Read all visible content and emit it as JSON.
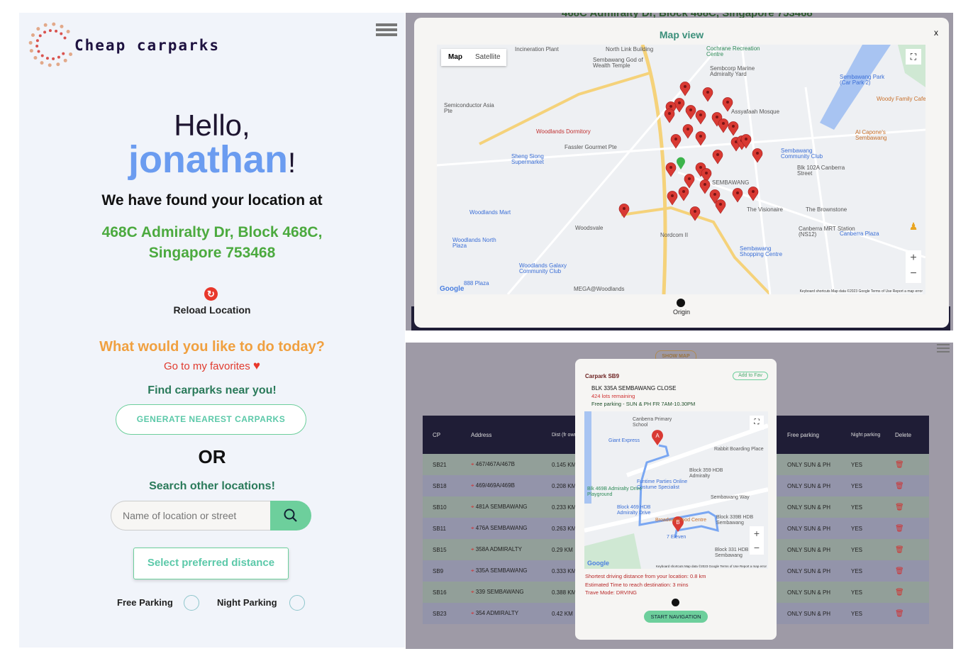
{
  "app": {
    "title": "Cheap carparks"
  },
  "home": {
    "greeting": "Hello,",
    "username": "jonathan",
    "exclaim": "!",
    "found_label": "We have found your location at",
    "address": "468C Admiralty Dr, Block 468C, Singapore 753468",
    "reload_label": "Reload Location",
    "question": "What would you like to do today?",
    "favorites_link": "Go to my favorites",
    "find_label": "Find carparks near you!",
    "generate_button": "GENERATE NEAREST CARPARKS",
    "or_label": "OR",
    "search_label": "Search other locations!",
    "search_placeholder": "Name of location or street",
    "distance_button": "Select preferred distance",
    "free_parking_label": "Free Parking",
    "night_parking_label": "Night Parking"
  },
  "map_modal": {
    "behind_address": "468C Admiralty Dr, Block 468C, Singapore 753468",
    "title": "Map view",
    "close": "x",
    "map_tab": "Map",
    "satellite_tab": "Satellite",
    "origin_label": "Origin",
    "footer": "Keyboard shortcuts   Map data ©2023 Google   Terms of Use   Report a map error",
    "labels": [
      {
        "t": "North Link Building",
        "c": ""
      },
      {
        "t": "Cochrane Recreation Centre",
        "c": "g"
      },
      {
        "t": "Incineration Plant",
        "c": ""
      },
      {
        "t": "Sembawang God of Wealth Temple",
        "c": ""
      },
      {
        "t": "Sembcorp Marine Admiralty Yard",
        "c": ""
      },
      {
        "t": "Semiconductor Asia Pte",
        "c": ""
      },
      {
        "t": "Woodlands Dormitory",
        "c": "r"
      },
      {
        "t": "Assyafaah Mosque",
        "c": ""
      },
      {
        "t": "Sembawang Park (Car Park 2)",
        "c": "b"
      },
      {
        "t": "Woody Family Cafe",
        "c": "o"
      },
      {
        "t": "Al Capone's Sembawang",
        "c": "o"
      },
      {
        "t": "Fassler Gourmet Pte",
        "c": ""
      },
      {
        "t": "Sheng Siong Supermarket",
        "c": "b"
      },
      {
        "t": "Sembawang Community Club",
        "c": "b"
      },
      {
        "t": "Blk 102A Canberra Street",
        "c": ""
      },
      {
        "t": "SEMBAWANG",
        "c": ""
      },
      {
        "t": "Woodlands Mart",
        "c": "b"
      },
      {
        "t": "The Visionaire",
        "c": ""
      },
      {
        "t": "The Brownstone",
        "c": ""
      },
      {
        "t": "Woodlands North Plaza",
        "c": "b"
      },
      {
        "t": "Canberra MRT Station (NS12)",
        "c": ""
      },
      {
        "t": "Canberra Plaza",
        "c": "b"
      },
      {
        "t": "Sembawang Shopping Centre",
        "c": "b"
      },
      {
        "t": "Woodlands Galaxy Community Club",
        "c": "b"
      },
      {
        "t": "888 Plaza",
        "c": "b"
      },
      {
        "t": "MEGA@Woodlands",
        "c": ""
      },
      {
        "t": "Nordcom II",
        "c": ""
      },
      {
        "t": "Woodsvale",
        "c": ""
      }
    ]
  },
  "table": {
    "show_map": "SHOW MAP",
    "headers": [
      "CP",
      "Address",
      "Dist (fr own)",
      "Free parking",
      "Night parking",
      "Delete"
    ],
    "rows": [
      [
        "SB21",
        "467/467A/467B",
        "0.145 KM",
        "ONLY SUN & PH",
        "YES"
      ],
      [
        "SB18",
        "469/469A/469B",
        "0.208 KM",
        "ONLY SUN & PH",
        "YES"
      ],
      [
        "SB10",
        "481A SEMBAWANG",
        "0.233 KM",
        "ONLY SUN & PH",
        "YES"
      ],
      [
        "SB11",
        "476A SEMBAWANG",
        "0.263 KM",
        "ONLY SUN & PH",
        "YES"
      ],
      [
        "SB15",
        "358A ADMIRALTY",
        "0.29 KM",
        "ONLY SUN & PH",
        "YES"
      ],
      [
        "SB9",
        "335A SEMBAWANG",
        "0.333 KM",
        "ONLY SUN & PH",
        "YES"
      ],
      [
        "SB16",
        "339 SEMBAWANG",
        "0.388 KM",
        "ONLY SUN & PH",
        "YES"
      ],
      [
        "SB23",
        "354 ADMIRALTY",
        "0.42 KM",
        "ONLY SUN & PH",
        "YES"
      ]
    ]
  },
  "carpark_card": {
    "title": "Carpark SB9",
    "fav_button": "Add to Fav",
    "address": "BLK 335A SEMBAWANG CLOSE",
    "lots": "424 lots remaining",
    "free_parking": "Free parking - SUN & PH FR 7AM-10.30PM",
    "distance": "Shortest driving distance from your location: 0.8 km",
    "time": "Estimated Time to reach destination: 3 mins",
    "mode": "Trave Mode: DRVING",
    "start_button": "START NAVIGATION",
    "map_footer": "Keyboard shortcuts   Map data ©2023 Google   Terms of Use   Report a map error",
    "map_labels": [
      {
        "t": "Canberra Primary School",
        "c": ""
      },
      {
        "t": "Giant Express",
        "c": "b"
      },
      {
        "t": "Rabbit Boarding Place",
        "c": ""
      },
      {
        "t": "Block 359 HDB Admiralty",
        "c": ""
      },
      {
        "t": "Funtime Parties Online Costume Specialist",
        "c": "b"
      },
      {
        "t": "Blk 469B Admiralty Drive Playground",
        "c": "g"
      },
      {
        "t": "Block 469 HDB Admiralty Drive",
        "c": "b"
      },
      {
        "t": "Sembawang Way",
        "c": ""
      },
      {
        "t": "Block 339B HDB Sembawang",
        "c": ""
      },
      {
        "t": "Broadway Food Centre",
        "c": "o"
      },
      {
        "t": "7 Eleven",
        "c": "b"
      },
      {
        "t": "Block 331 HDB Sembawang",
        "c": ""
      }
    ]
  },
  "colors": {
    "accent_blue": "#6b9cf0",
    "green_text": "#4caa3f",
    "orange": "#f0a040",
    "button_green": "#6dcf9c",
    "header_dark": "#1f1d36"
  }
}
